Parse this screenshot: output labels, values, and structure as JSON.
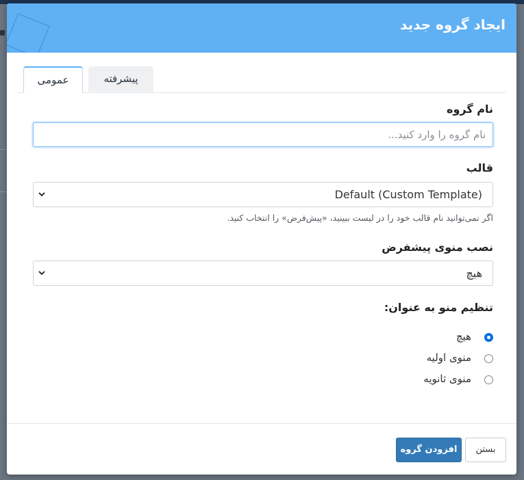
{
  "modal": {
    "title": "ایجاد گروه جدید"
  },
  "tabs": {
    "general": "عمومی",
    "advanced": "پیشرفته"
  },
  "form": {
    "group_name_label": "نام گروه",
    "group_name_placeholder": "نام گروه را وارد کنید...",
    "group_name_value": "",
    "template_label": "قالب",
    "template_selected": "Default (Custom Template)",
    "template_help": "اگر نمی‌توانید نام قالب خود را در لیست ببینید، «پیش‌فرض» را انتخاب کنید.",
    "default_menu_label": "نصب منوی پیشفرض",
    "default_menu_selected": "هیچ",
    "menu_as_label": "تنظیم منو به عنوان:",
    "menu_as_options": [
      {
        "label": "هیچ",
        "checked": true
      },
      {
        "label": "منوی اولیه",
        "checked": false
      },
      {
        "label": "منوی ثانویه",
        "checked": false
      }
    ]
  },
  "footer": {
    "close_label": "بستن",
    "add_label": "افزودن گروه"
  },
  "colors": {
    "header": "#60b0f4",
    "primary_button": "#337ab7",
    "radio_checked": "#0b6fe0"
  },
  "icons": {
    "select_chevron": "chevron-down-icon"
  }
}
